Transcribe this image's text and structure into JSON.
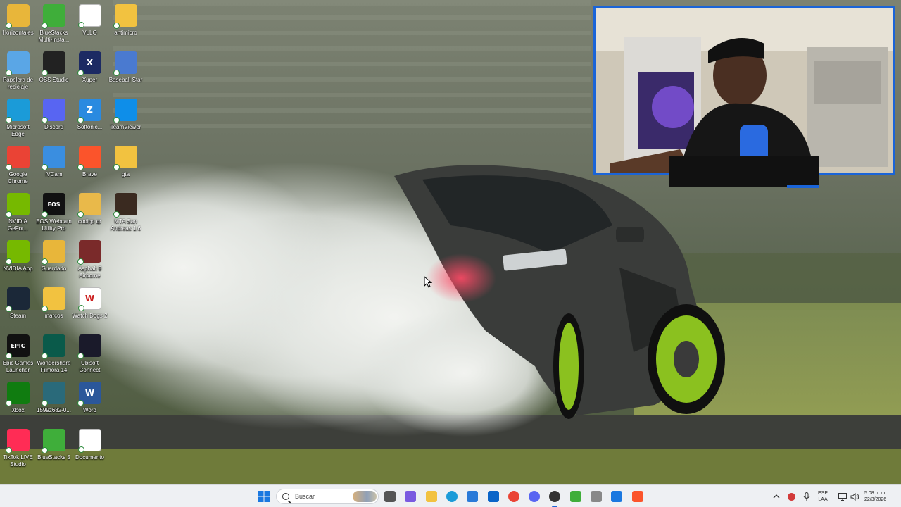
{
  "desktop_icons": [
    {
      "label": "Horizontales",
      "icon": "folder-icon",
      "color": "#e8b63a",
      "glyph": ""
    },
    {
      "label": "BlueStacks Multi-Insta...",
      "icon": "bluestacks-multi-icon",
      "color": "#3fae3a",
      "glyph": ""
    },
    {
      "label": "VLLO",
      "icon": "vllo-icon",
      "color": "#ffffff",
      "glyph": ""
    },
    {
      "label": "antimicro",
      "icon": "folder-icon",
      "color": "#f2c240",
      "glyph": ""
    },
    {
      "label": "Papelera de reciclaje",
      "icon": "recycle-bin-icon",
      "color": "#5aa6e6",
      "glyph": ""
    },
    {
      "label": "OBS Studio",
      "icon": "obs-icon",
      "color": "#222222",
      "glyph": ""
    },
    {
      "label": "Xuper",
      "icon": "xuper-icon",
      "color": "#1c2a63",
      "glyph": "X"
    },
    {
      "label": "Baseball Star",
      "icon": "baseball-star-icon",
      "color": "#4a7ad0",
      "glyph": ""
    },
    {
      "label": "Microsoft Edge",
      "icon": "edge-icon",
      "color": "#1b9bd8",
      "glyph": ""
    },
    {
      "label": "Discord",
      "icon": "discord-icon",
      "color": "#5865f2",
      "glyph": ""
    },
    {
      "label": "Softonic...",
      "icon": "softonic-icon",
      "color": "#2a8ae0",
      "glyph": "Z"
    },
    {
      "label": "TeamViewer",
      "icon": "teamviewer-icon",
      "color": "#0e8ee9",
      "glyph": ""
    },
    {
      "label": "Google Chrome",
      "icon": "chrome-icon",
      "color": "#ea4335",
      "glyph": ""
    },
    {
      "label": "iVCam",
      "icon": "ivcam-icon",
      "color": "#3a8ee0",
      "glyph": ""
    },
    {
      "label": "Brave",
      "icon": "brave-icon",
      "color": "#fb542b",
      "glyph": ""
    },
    {
      "label": "gta",
      "icon": "zip-folder-icon",
      "color": "#f2c240",
      "glyph": ""
    },
    {
      "label": "NVIDIA GeFor...",
      "icon": "nvidia-geforce-icon",
      "color": "#76b900",
      "glyph": ""
    },
    {
      "label": "EOS Webcam Utility Pro",
      "icon": "eos-webcam-icon",
      "color": "#111111",
      "glyph": "EOS"
    },
    {
      "label": "codigo qr",
      "icon": "zip-folder-icon",
      "color": "#e9b94a",
      "glyph": ""
    },
    {
      "label": "MTA San Andreas 1.6",
      "icon": "mta-icon",
      "color": "#3a2a20",
      "glyph": ""
    },
    {
      "label": "NVIDIA App",
      "icon": "nvidia-app-icon",
      "color": "#76b900",
      "glyph": ""
    },
    {
      "label": "Guardado",
      "icon": "folder-icon",
      "color": "#e8b63a",
      "glyph": ""
    },
    {
      "label": "Asphalt 8 Airborne",
      "icon": "asphalt-icon",
      "color": "#7a2a2a",
      "glyph": ""
    },
    {
      "label": "",
      "icon": "",
      "color": "",
      "glyph": ""
    },
    {
      "label": "Steam",
      "icon": "steam-icon",
      "color": "#1b2838",
      "glyph": ""
    },
    {
      "label": "marcos",
      "icon": "folder-icon",
      "color": "#f2c240",
      "glyph": ""
    },
    {
      "label": "Watch Dogs 2",
      "icon": "watch-dogs-icon",
      "color": "#ffffff",
      "glyph": "W"
    },
    {
      "label": "",
      "icon": "",
      "color": "",
      "glyph": ""
    },
    {
      "label": "Epic Games Launcher",
      "icon": "epic-games-icon",
      "color": "#111111",
      "glyph": "EPIC"
    },
    {
      "label": "Wondershare Filmora 14",
      "icon": "filmora-icon",
      "color": "#0a5a4a",
      "glyph": ""
    },
    {
      "label": "Ubisoft Connect",
      "icon": "ubisoft-icon",
      "color": "#1a1a2a",
      "glyph": ""
    },
    {
      "label": "",
      "icon": "",
      "color": "",
      "glyph": ""
    },
    {
      "label": "Xbox",
      "icon": "xbox-icon",
      "color": "#107c10",
      "glyph": ""
    },
    {
      "label": "1599z682-0...",
      "icon": "image-file-icon",
      "color": "#2a6a7a",
      "glyph": ""
    },
    {
      "label": "Word",
      "icon": "word-icon",
      "color": "#2b579a",
      "glyph": "W"
    },
    {
      "label": "",
      "icon": "",
      "color": "",
      "glyph": ""
    },
    {
      "label": "TikTok LIVE Studio",
      "icon": "tiktok-live-icon",
      "color": "#ff2c55",
      "glyph": ""
    },
    {
      "label": "BlueStacks 5",
      "icon": "bluestacks-icon",
      "color": "#3fae3a",
      "glyph": ""
    },
    {
      "label": "Documento",
      "icon": "document-icon",
      "color": "#ffffff",
      "glyph": ""
    }
  ],
  "taskbar": {
    "search_placeholder": "Buscar",
    "pinned": [
      {
        "name": "task-view-icon",
        "color": "#555555"
      },
      {
        "name": "copilot-icon",
        "color": "#7a5ae0"
      },
      {
        "name": "file-explorer-icon",
        "color": "#f2c240"
      },
      {
        "name": "edge-icon",
        "color": "#1b9bd8"
      },
      {
        "name": "store-icon",
        "color": "#2a7ad8"
      },
      {
        "name": "outlook-icon",
        "color": "#0a64c8"
      },
      {
        "name": "chrome-icon",
        "color": "#ea4335"
      },
      {
        "name": "discord-icon",
        "color": "#5865f2"
      },
      {
        "name": "obs-icon",
        "color": "#333333"
      },
      {
        "name": "bluestacks-icon",
        "color": "#3fae3a"
      },
      {
        "name": "tool-icon",
        "color": "#888888"
      },
      {
        "name": "defender-icon",
        "color": "#1a78e0"
      },
      {
        "name": "brave-icon",
        "color": "#fb542b"
      }
    ],
    "tray": {
      "language_line1": "ESP",
      "language_line2": "LAA",
      "time": "5:08 p. m.",
      "date": "22/3/2026"
    }
  },
  "colors": {
    "accent": "#1a64d8",
    "taskbar_bg": "#eef0f3"
  }
}
